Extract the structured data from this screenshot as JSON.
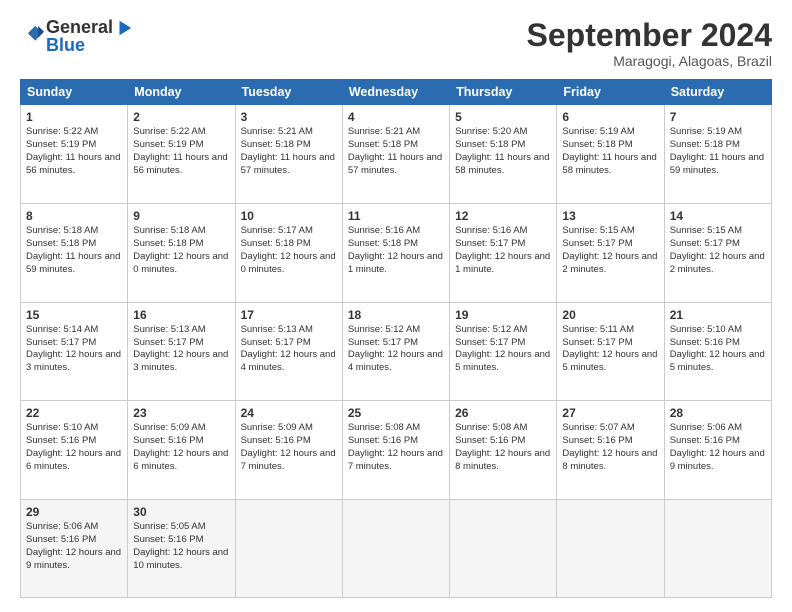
{
  "logo": {
    "general": "General",
    "blue": "Blue"
  },
  "header": {
    "month": "September 2024",
    "location": "Maragogi, Alagoas, Brazil"
  },
  "days": [
    "Sunday",
    "Monday",
    "Tuesday",
    "Wednesday",
    "Thursday",
    "Friday",
    "Saturday"
  ],
  "weeks": [
    [
      {
        "date": "1",
        "sunrise": "5:22 AM",
        "sunset": "5:19 PM",
        "daylight": "11 hours and 56 minutes."
      },
      {
        "date": "2",
        "sunrise": "5:22 AM",
        "sunset": "5:19 PM",
        "daylight": "11 hours and 56 minutes."
      },
      {
        "date": "3",
        "sunrise": "5:21 AM",
        "sunset": "5:18 PM",
        "daylight": "11 hours and 57 minutes."
      },
      {
        "date": "4",
        "sunrise": "5:21 AM",
        "sunset": "5:18 PM",
        "daylight": "11 hours and 57 minutes."
      },
      {
        "date": "5",
        "sunrise": "5:20 AM",
        "sunset": "5:18 PM",
        "daylight": "11 hours and 58 minutes."
      },
      {
        "date": "6",
        "sunrise": "5:19 AM",
        "sunset": "5:18 PM",
        "daylight": "11 hours and 58 minutes."
      },
      {
        "date": "7",
        "sunrise": "5:19 AM",
        "sunset": "5:18 PM",
        "daylight": "11 hours and 59 minutes."
      }
    ],
    [
      {
        "date": "8",
        "sunrise": "5:18 AM",
        "sunset": "5:18 PM",
        "daylight": "11 hours and 59 minutes."
      },
      {
        "date": "9",
        "sunrise": "5:18 AM",
        "sunset": "5:18 PM",
        "daylight": "12 hours and 0 minutes."
      },
      {
        "date": "10",
        "sunrise": "5:17 AM",
        "sunset": "5:18 PM",
        "daylight": "12 hours and 0 minutes."
      },
      {
        "date": "11",
        "sunrise": "5:16 AM",
        "sunset": "5:18 PM",
        "daylight": "12 hours and 1 minute."
      },
      {
        "date": "12",
        "sunrise": "5:16 AM",
        "sunset": "5:17 PM",
        "daylight": "12 hours and 1 minute."
      },
      {
        "date": "13",
        "sunrise": "5:15 AM",
        "sunset": "5:17 PM",
        "daylight": "12 hours and 2 minutes."
      },
      {
        "date": "14",
        "sunrise": "5:15 AM",
        "sunset": "5:17 PM",
        "daylight": "12 hours and 2 minutes."
      }
    ],
    [
      {
        "date": "15",
        "sunrise": "5:14 AM",
        "sunset": "5:17 PM",
        "daylight": "12 hours and 3 minutes."
      },
      {
        "date": "16",
        "sunrise": "5:13 AM",
        "sunset": "5:17 PM",
        "daylight": "12 hours and 3 minutes."
      },
      {
        "date": "17",
        "sunrise": "5:13 AM",
        "sunset": "5:17 PM",
        "daylight": "12 hours and 4 minutes."
      },
      {
        "date": "18",
        "sunrise": "5:12 AM",
        "sunset": "5:17 PM",
        "daylight": "12 hours and 4 minutes."
      },
      {
        "date": "19",
        "sunrise": "5:12 AM",
        "sunset": "5:17 PM",
        "daylight": "12 hours and 5 minutes."
      },
      {
        "date": "20",
        "sunrise": "5:11 AM",
        "sunset": "5:17 PM",
        "daylight": "12 hours and 5 minutes."
      },
      {
        "date": "21",
        "sunrise": "5:10 AM",
        "sunset": "5:16 PM",
        "daylight": "12 hours and 5 minutes."
      }
    ],
    [
      {
        "date": "22",
        "sunrise": "5:10 AM",
        "sunset": "5:16 PM",
        "daylight": "12 hours and 6 minutes."
      },
      {
        "date": "23",
        "sunrise": "5:09 AM",
        "sunset": "5:16 PM",
        "daylight": "12 hours and 6 minutes."
      },
      {
        "date": "24",
        "sunrise": "5:09 AM",
        "sunset": "5:16 PM",
        "daylight": "12 hours and 7 minutes."
      },
      {
        "date": "25",
        "sunrise": "5:08 AM",
        "sunset": "5:16 PM",
        "daylight": "12 hours and 7 minutes."
      },
      {
        "date": "26",
        "sunrise": "5:08 AM",
        "sunset": "5:16 PM",
        "daylight": "12 hours and 8 minutes."
      },
      {
        "date": "27",
        "sunrise": "5:07 AM",
        "sunset": "5:16 PM",
        "daylight": "12 hours and 8 minutes."
      },
      {
        "date": "28",
        "sunrise": "5:06 AM",
        "sunset": "5:16 PM",
        "daylight": "12 hours and 9 minutes."
      }
    ],
    [
      {
        "date": "29",
        "sunrise": "5:06 AM",
        "sunset": "5:16 PM",
        "daylight": "12 hours and 9 minutes."
      },
      {
        "date": "30",
        "sunrise": "5:05 AM",
        "sunset": "5:16 PM",
        "daylight": "12 hours and 10 minutes."
      },
      null,
      null,
      null,
      null,
      null
    ]
  ]
}
